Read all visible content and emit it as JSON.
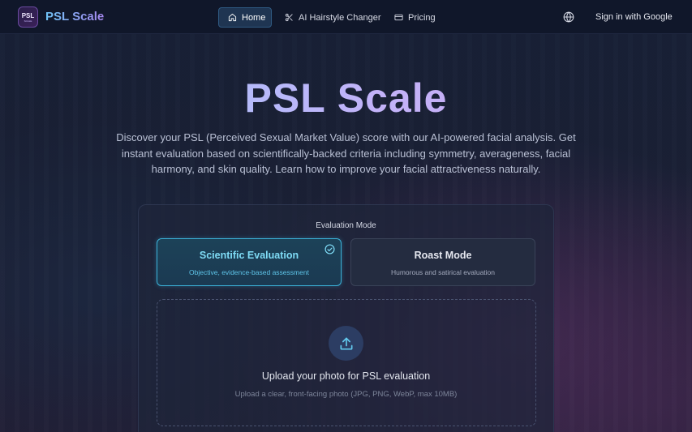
{
  "header": {
    "logo_line1": "PSL",
    "logo_line2": "SCALE",
    "brand": "PSL Scale",
    "nav": [
      {
        "label": "Home",
        "icon": "home-icon",
        "active": true
      },
      {
        "label": "AI Hairstyle Changer",
        "icon": "scissors-icon",
        "active": false
      },
      {
        "label": "Pricing",
        "icon": "credit-card-icon",
        "active": false
      }
    ],
    "language_icon": "globe-icon",
    "signin_label": "Sign in with Google"
  },
  "hero": {
    "title": "PSL Scale",
    "description": "Discover your PSL (Perceived Sexual Market Value) score with our AI-powered facial analysis. Get instant evaluation based on scientifically-backed criteria including symmetry, averageness, facial harmony, and skin quality. Learn how to improve your facial attractiveness naturally."
  },
  "evaluation": {
    "label": "Evaluation Mode",
    "modes": [
      {
        "title": "Scientific Evaluation",
        "subtitle": "Objective, evidence-based assessment",
        "selected": true
      },
      {
        "title": "Roast Mode",
        "subtitle": "Humorous and satirical evaluation",
        "selected": false
      }
    ]
  },
  "upload": {
    "icon": "upload-icon",
    "title": "Upload your photo for PSL evaluation",
    "subtitle": "Upload a clear, front-facing photo (JPG, PNG, WebP, max 10MB)"
  },
  "colors": {
    "accent": "#3bb2d9",
    "background": "#141a2c",
    "header": "#10172a"
  }
}
